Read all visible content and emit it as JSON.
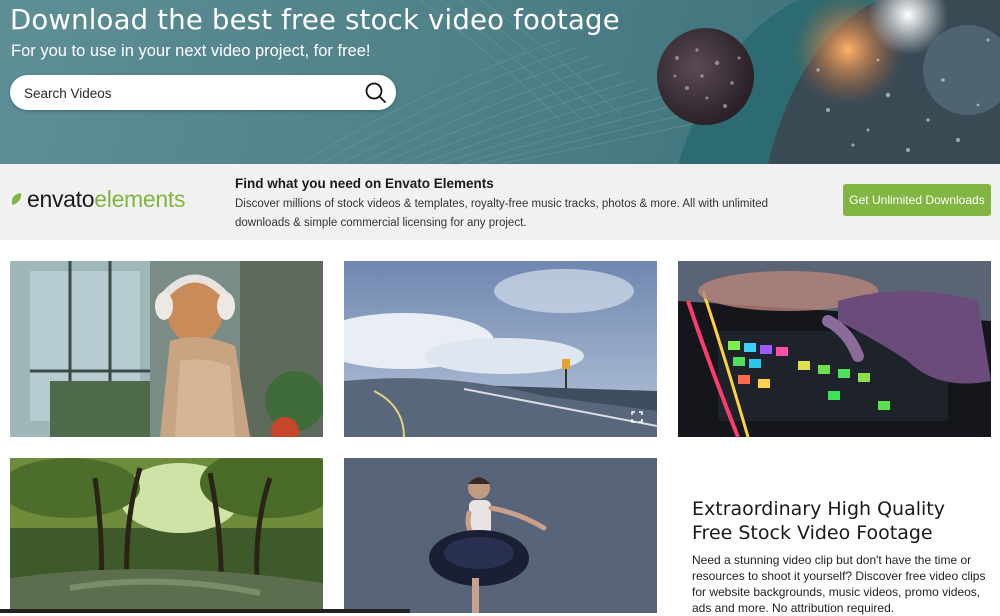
{
  "hero": {
    "title": "Download the best free stock video footage",
    "subtitle": "For you to use in your next video project, for free!",
    "search": {
      "placeholder": "Search Videos",
      "icon": "search-icon"
    }
  },
  "banner": {
    "logo_part1": "envato",
    "logo_part2": "elements",
    "title": "Find what you need on Envato Elements",
    "description": "Discover millions of stock videos & templates, royalty-free music tracks, photos & more. All with unlimited downloads & simple commercial licensing for any project.",
    "cta_label": "Get Unlimited Downloads",
    "accent_color": "#82b541"
  },
  "videos": [
    {
      "subject": "woman with headphones dancing by window"
    },
    {
      "subject": "mountain road with clouds"
    },
    {
      "subject": "hands typing on RGB keyboard"
    },
    {
      "subject": "forest river"
    },
    {
      "subject": "ballerina dancing"
    }
  ],
  "side": {
    "heading_line1": "Extraordinary High Quality",
    "heading_line2": "Free Stock Video Footage",
    "text": "Need a stunning video clip but don't have the time or resources to shoot it yourself? Discover free video clips for website backgrounds, music videos, promo videos, ads and more. No attribution required."
  }
}
